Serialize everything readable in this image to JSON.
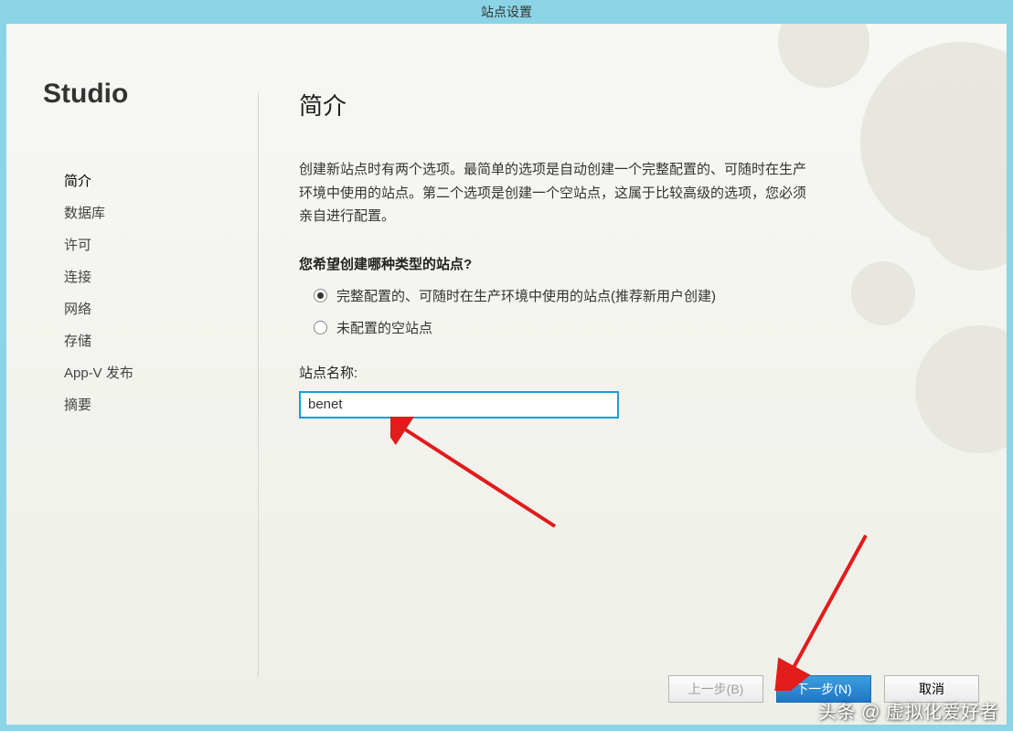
{
  "title": "站点设置",
  "logo": "Studio",
  "nav": {
    "items": [
      "简介",
      "数据库",
      "许可",
      "连接",
      "网络",
      "存储",
      "App-V 发布",
      "摘要"
    ],
    "selected_index": 0
  },
  "main": {
    "heading": "简介",
    "intro": "创建新站点时有两个选项。最简单的选项是自动创建一个完整配置的、可随时在生产环境中使用的站点。第二个选项是创建一个空站点，这属于比较高级的选项，您必须亲自进行配置。",
    "question": "您希望创建哪种类型的站点?",
    "options": {
      "opt0": "完整配置的、可随时在生产环境中使用的站点(推荐新用户创建)",
      "opt1": "未配置的空站点",
      "selected": 0
    },
    "site_name_label": "站点名称:",
    "site_name_value": "benet"
  },
  "buttons": {
    "back": "上一步(B)",
    "next": "下一步(N)",
    "cancel": "取消"
  },
  "watermark": "头条 @ 虚拟化爱好者"
}
